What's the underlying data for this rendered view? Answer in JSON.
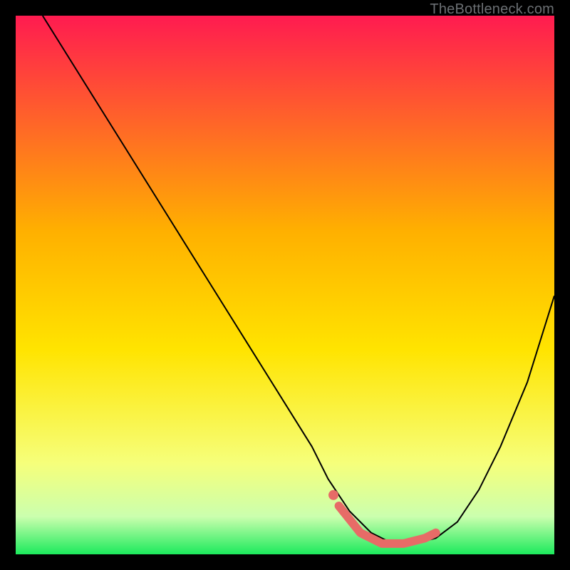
{
  "watermark": "TheBottleneck.com",
  "chart_data": {
    "type": "line",
    "title": "",
    "xlabel": "",
    "ylabel": "",
    "xlim": [
      0,
      100
    ],
    "ylim": [
      0,
      100
    ],
    "gradient": {
      "top_color": "#ff1b50",
      "mid_color": "#ffe400",
      "bottom_color": "#1cea5c"
    },
    "series": [
      {
        "name": "bottleneck-curve",
        "x": [
          5,
          10,
          15,
          20,
          25,
          30,
          35,
          40,
          45,
          50,
          55,
          58,
          62,
          66,
          70,
          74,
          78,
          82,
          86,
          90,
          95,
          100
        ],
        "y": [
          100,
          92,
          84,
          76,
          68,
          60,
          52,
          44,
          36,
          28,
          20,
          14,
          8,
          4,
          2,
          2,
          3,
          6,
          12,
          20,
          32,
          48
        ]
      }
    ],
    "highlight_segment": {
      "name": "min-region",
      "color": "#e76b67",
      "x": [
        60,
        64,
        68,
        72,
        76,
        78
      ],
      "y": [
        9,
        4,
        2,
        2,
        3,
        4
      ]
    },
    "highlight_dot": {
      "x": 59,
      "y": 11,
      "color": "#e76b67"
    }
  }
}
